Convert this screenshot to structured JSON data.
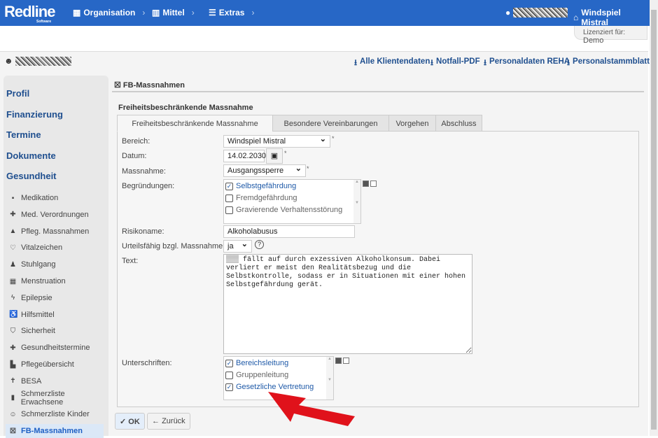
{
  "header": {
    "logo": "Redline",
    "logo_sub": "Software",
    "nav": [
      {
        "label": "Organisation",
        "icon": "building-icon"
      },
      {
        "label": "Mittel",
        "icon": "book-icon"
      },
      {
        "label": "Extras",
        "icon": "menu-icon"
      }
    ],
    "location": "Windspiel Mistral",
    "license_label": "Lizenziert für:",
    "license_value": "Demo"
  },
  "downloads": [
    "Alle Klientendaten",
    "Notfall-PDF",
    "Personaldaten REHA",
    "Personalstammblatt"
  ],
  "sidebar": {
    "sections": [
      "Profil",
      "Finanzierung",
      "Termine",
      "Dokumente",
      "Gesundheit"
    ],
    "items": [
      {
        "label": "Medikation",
        "icon": "▪"
      },
      {
        "label": "Med. Verordnungen",
        "icon": "✚"
      },
      {
        "label": "Pfleg. Massnahmen",
        "icon": "▲"
      },
      {
        "label": "Vitalzeichen",
        "icon": "♡"
      },
      {
        "label": "Stuhlgang",
        "icon": "♟"
      },
      {
        "label": "Menstruation",
        "icon": "▦"
      },
      {
        "label": "Epilepsie",
        "icon": "ϟ"
      },
      {
        "label": "Hilfsmittel",
        "icon": "♿"
      },
      {
        "label": "Sicherheit",
        "icon": "⛉"
      },
      {
        "label": "Gesundheitstermine",
        "icon": "✚"
      },
      {
        "label": "Pflegeübersicht",
        "icon": "▙"
      },
      {
        "label": "BESA",
        "icon": "✝"
      },
      {
        "label": "Schmerzliste Erwachsene",
        "icon": "▮"
      },
      {
        "label": "Schmerzliste Kinder",
        "icon": "☺"
      },
      {
        "label": "FB-Massnahmen",
        "icon": "☒"
      }
    ],
    "active": "FB-Massnahmen"
  },
  "page": {
    "title": "FB-Massnahmen",
    "form_title": "Freiheitsbeschränkende Massnahme"
  },
  "tabs": [
    "Freiheitsbeschränkende Massnahme",
    "Besondere Vereinbarungen",
    "Vorgehen",
    "Abschluss"
  ],
  "form": {
    "bereich": {
      "label": "Bereich:",
      "value": "Windspiel Mistral"
    },
    "datum": {
      "label": "Datum:",
      "value": "14.02.2030"
    },
    "massnahme": {
      "label": "Massnahme:",
      "value": "Ausgangssperre"
    },
    "begruendungen": {
      "label": "Begründungen:",
      "options": [
        {
          "label": "Selbstgefährdung",
          "checked": true
        },
        {
          "label": "Fremdgefährdung",
          "checked": false
        },
        {
          "label": "Gravierende Verhaltensstörung",
          "checked": false
        }
      ]
    },
    "risikoname": {
      "label": "Risikoname:",
      "value": "Alkoholabusus"
    },
    "urteilsfaehig": {
      "label": "Urteilsfähig bzgl. Massnahme:",
      "value": "ja"
    },
    "text": {
      "label": "Text:",
      "value": "fällt auf durch exzessiven Alkoholkonsum. Dabei verliert er meist den Realitätsbezug und die Selbstkontrolle, sodass er in Situationen mit einer hohen Selbstgefährdung gerät."
    },
    "unterschriften": {
      "label": "Unterschriften:",
      "options": [
        {
          "label": "Bereichsleitung",
          "checked": true
        },
        {
          "label": "Gruppenleitung",
          "checked": false
        },
        {
          "label": "Gesetzliche Vertretung",
          "checked": true
        }
      ]
    },
    "required_mark": "*"
  },
  "buttons": {
    "ok": "OK",
    "back": "Zurück"
  },
  "colors": {
    "header": "#2767c6",
    "link": "#1f4f8f",
    "arrow": "#e0121b"
  }
}
